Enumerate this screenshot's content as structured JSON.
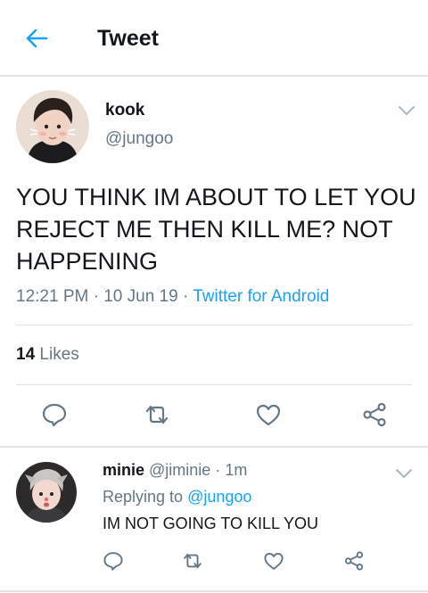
{
  "header": {
    "title": "Tweet"
  },
  "tweet": {
    "name": "kook",
    "handle": "@jungoo",
    "text": "YOU THINK IM ABOUT TO LET YOU REJECT ME THEN KILL ME? NOT HAPPENING",
    "time": "12:21 PM",
    "date": "10 Jun 19",
    "source": "Twitter for Android",
    "dot": "·",
    "likes_count": "14",
    "likes_label": "Likes"
  },
  "reply": {
    "name": "minie",
    "handle": "@jiminie",
    "dot": "·",
    "age": "1m",
    "replying_to_label": "Replying to",
    "replying_to_handle": "@jungoo",
    "text": "IM NOT GOING TO KILL YOU"
  },
  "icons": {
    "back": "arrow-left-icon",
    "chevron": "chevron-down-icon",
    "reply": "comment-icon",
    "retweet": "retweet-icon",
    "like": "heart-icon",
    "share": "share-icon"
  },
  "colors": {
    "accent": "#1da1f2",
    "text": "#14171a",
    "muted": "#657786",
    "divider": "#e1e4e6"
  }
}
